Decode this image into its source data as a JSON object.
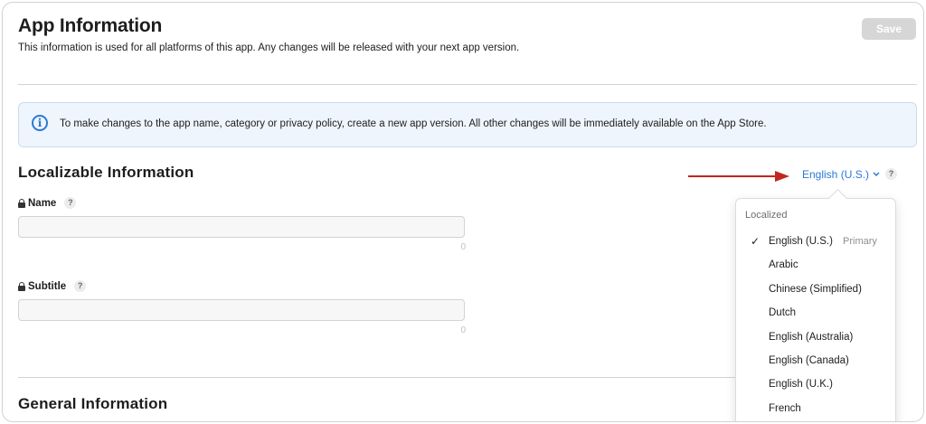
{
  "header": {
    "title": "App Information",
    "description": "This information is used for all platforms of this app. Any changes will be released with your next app version.",
    "save_label": "Save"
  },
  "banner": {
    "icon": "info-icon",
    "text": "To make changes to the app name, category or privacy policy, create a new app version. All other changes will be immediately available on the App Store."
  },
  "localizable": {
    "title": "Localizable Information",
    "language_selected": "English (U.S.)",
    "help": "?"
  },
  "fields": {
    "name": {
      "label": "Name",
      "help": "?",
      "value": "",
      "count": "0"
    },
    "subtitle": {
      "label": "Subtitle",
      "help": "?",
      "value": "",
      "count": "0"
    }
  },
  "general": {
    "title": "General Information"
  },
  "dropdown": {
    "heading": "Localized",
    "items": [
      {
        "label": "English (U.S.)",
        "checked": "✓",
        "badge": "Primary"
      },
      {
        "label": "Arabic"
      },
      {
        "label": "Chinese (Simplified)"
      },
      {
        "label": "Dutch"
      },
      {
        "label": "English (Australia)"
      },
      {
        "label": "English (Canada)"
      },
      {
        "label": "English (U.K.)"
      },
      {
        "label": "French"
      }
    ]
  },
  "colors": {
    "accent": "#2a7ad5",
    "annotation_arrow": "#c0271f",
    "banner_bg": "#eef5fc"
  }
}
